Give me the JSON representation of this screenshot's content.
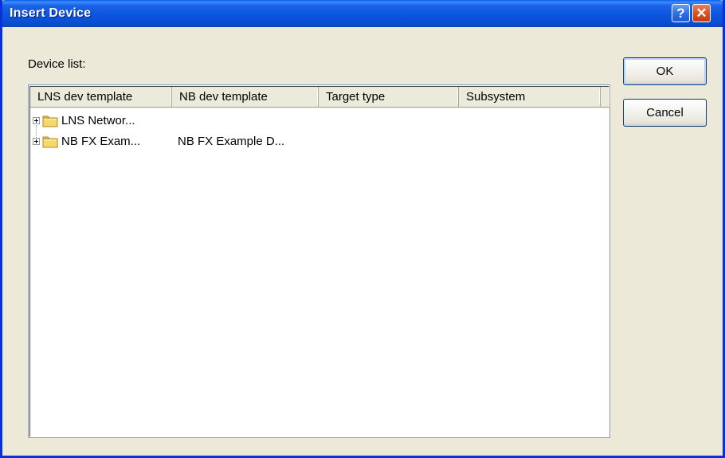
{
  "window": {
    "title": "Insert Device",
    "help_glyph": "?",
    "close_glyph": "✕"
  },
  "device_list": {
    "label": "Device list:",
    "columns": [
      "LNS dev template",
      "NB dev template",
      "Target type",
      "Subsystem"
    ],
    "rows": [
      {
        "lns": "LNS Networ...",
        "nb": "",
        "target": "",
        "subsystem": "",
        "expander": "plus-icon",
        "icon": "folder-icon"
      },
      {
        "lns": "NB FX Exam...",
        "nb": "NB FX Example D...",
        "target": "",
        "subsystem": "",
        "expander": "plus-icon",
        "icon": "folder-icon"
      }
    ]
  },
  "buttons": {
    "ok_label": "OK",
    "cancel_label": "Cancel"
  },
  "colors": {
    "titlebar": "#0a4ecf",
    "dialog_bg": "#ece9d8",
    "close_button": "#d9531f",
    "folder": "#f5d86b"
  }
}
